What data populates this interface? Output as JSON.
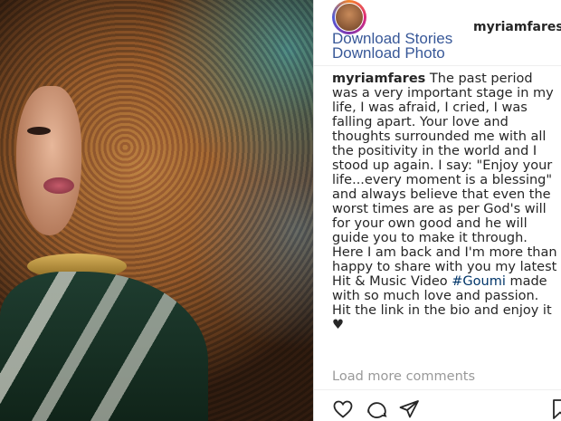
{
  "post": {
    "username": "myriamfares"
  },
  "extension": {
    "download_stories": "Download Stories",
    "download_photo": "Download Photo"
  },
  "caption": {
    "username": "myriamfares",
    "text_before_tag": " The past period was a very important stage in my life, I was afraid, I cried, I was falling apart. Your love and thoughts surrounded me with all the positivity in the world and I stood up again. I say: \"Enjoy your life...every moment is a blessing\" and always believe that even the worst times are as per God's will for your own good and he will guide you to make it through. Here I am back and I'm more than happy to share with you my latest Hit & Music Video ",
    "hashtag": "#Goumi",
    "text_after_tag": " made with so much love and passion. Hit the link in the bio and enjoy it ",
    "emoji": "♥"
  },
  "comments": {
    "load_more": "Load more comments"
  },
  "actions": {
    "like_icon": "heart-icon",
    "comment_icon": "speech-bubble-icon",
    "share_icon": "paper-plane-icon",
    "save_icon": "bookmark-icon"
  },
  "colors": {
    "link_blue": "#385898",
    "text": "#262626",
    "muted": "#999999",
    "hashtag": "#003569"
  }
}
